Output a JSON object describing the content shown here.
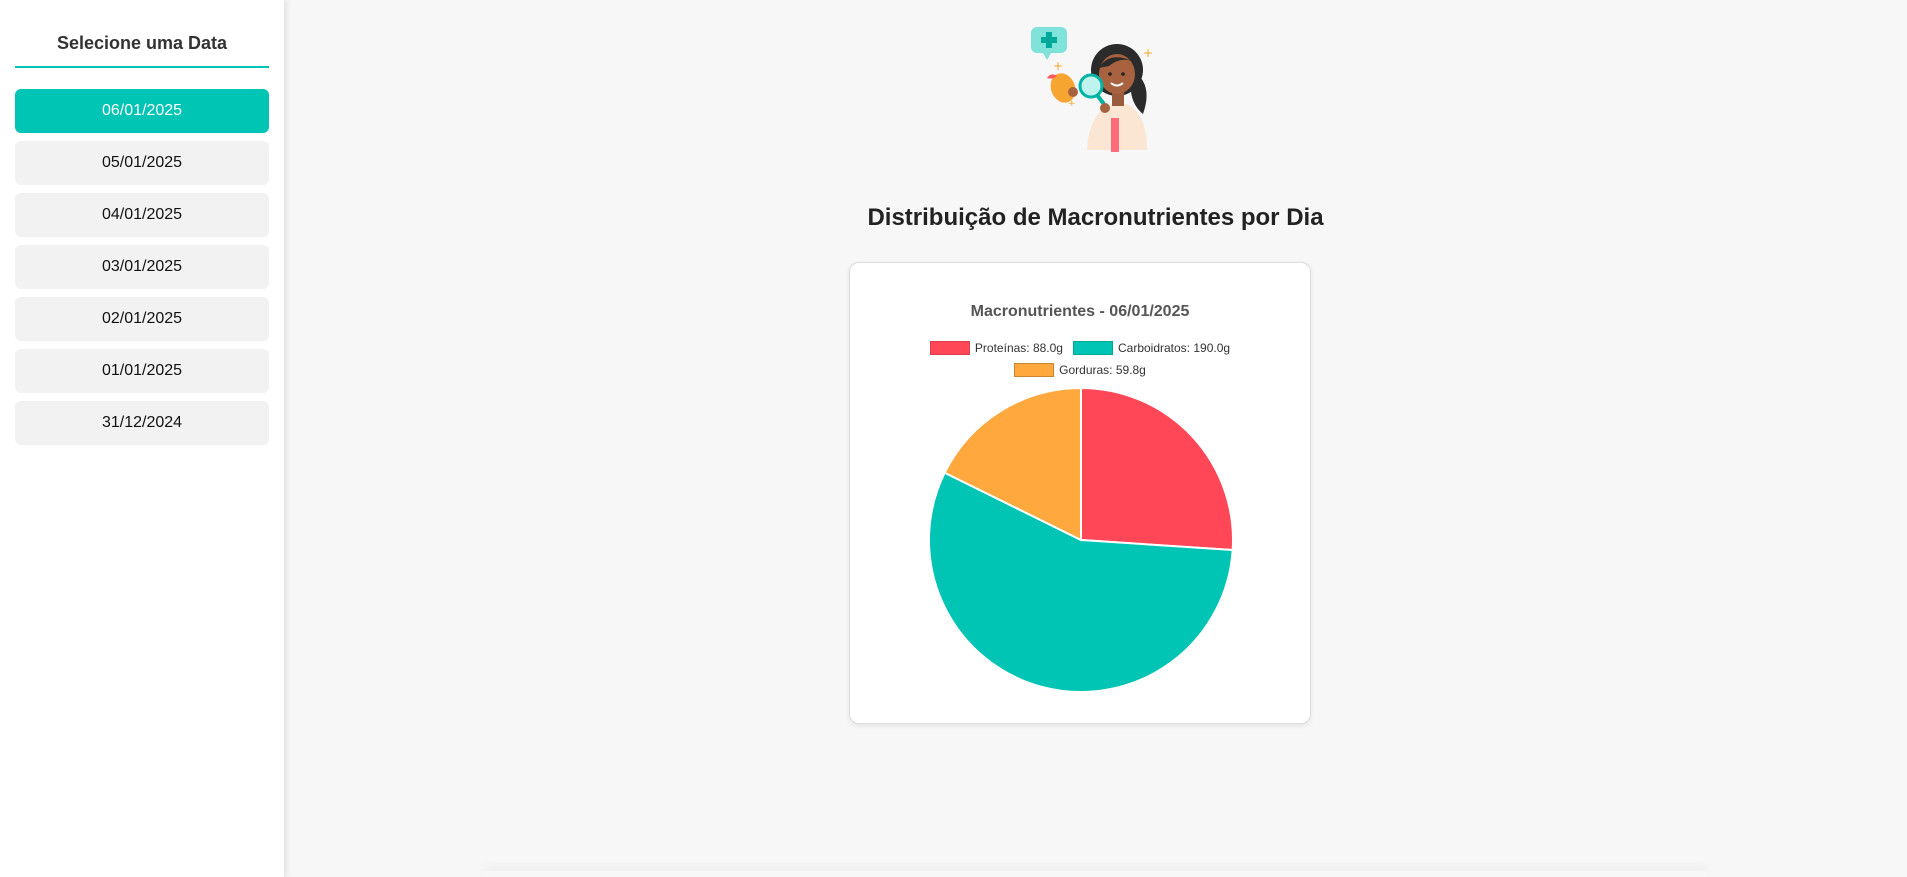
{
  "sidebar": {
    "title": "Selecione uma Data",
    "dates": [
      "06/01/2025",
      "05/01/2025",
      "04/01/2025",
      "03/01/2025",
      "02/01/2025",
      "01/01/2025",
      "31/12/2024"
    ],
    "selected_index": 0
  },
  "main": {
    "title": "Distribuição de Macronutrientes por Dia"
  },
  "colors": {
    "accent": "#00c4b4",
    "proteins": "#ff4757",
    "carbs": "#00c4b4",
    "fats": "#ffa83d"
  },
  "chart_data": {
    "type": "pie",
    "title": "Macronutrientes - 06/01/2025",
    "legend_placement": "top",
    "slices": [
      {
        "label": "Proteínas",
        "value": 88.0,
        "legend": "Proteínas: 88.0g",
        "color": "#ff4757"
      },
      {
        "label": "Carboidratos",
        "value": 190.0,
        "legend": "Carboidratos: 190.0g",
        "color": "#00c4b4"
      },
      {
        "label": "Gorduras",
        "value": 59.8,
        "legend": "Gorduras: 59.8g",
        "color": "#ffa83d"
      }
    ]
  }
}
